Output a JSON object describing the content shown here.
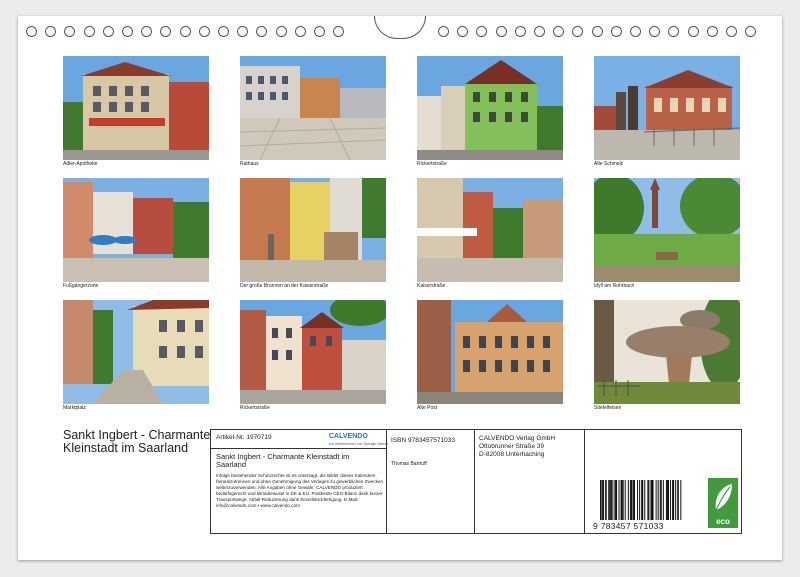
{
  "photos": [
    {
      "caption": "Adler-Apotheke"
    },
    {
      "caption": "Rathaus"
    },
    {
      "caption": "Rickertstraße"
    },
    {
      "caption": "Alte Schmelz"
    },
    {
      "caption": "Fußgängerzone"
    },
    {
      "caption": "Der große Brunnen an der Kaiserstraße"
    },
    {
      "caption": "Kaiserstraße"
    },
    {
      "caption": "Idyll am Rohrbach"
    },
    {
      "caption": "Marktplatz"
    },
    {
      "caption": "Rickertstraße"
    },
    {
      "caption": "Alte Post"
    },
    {
      "caption": "Stiefelfelsen"
    }
  ],
  "footer": {
    "title": "Sankt Ingbert - Charmante Kleinstadt im Saarland",
    "article_no": "Artikel-Nr. 1970719",
    "brand": "CALVENDO",
    "brand_sub": "ein Unternehmen von Springer Nature",
    "calendar_title": "Sankt Ingbert - Charmante Kleinstadt im Saarland",
    "legal_text": "Infolge bestehender Schutzrechte ist es untersagt, die Bilder dieses Kalenders herauszutrennen und ohne Genehmigung des Verlages zu gewerblichen Zwecken weiterzuverwenden. Alle Angaben ohne Gewähr. CALVENDO produziert bedarfsgerecht und klimabewusst in DE & EU. Postbeste CEG-Bilanz dank kurzer Transportwege. Abfall-Reduzierung dank Einzelstückfertigung. E-Mail: info@calvendo.com • www.calvendo.com",
    "isbn": "ISBN 9783457571033",
    "author": "Thomas Bartruff",
    "publisher_lines": [
      "CALVENDO Verlag GmbH",
      "Ottobrunner Straße 39",
      "D-82008 Unterhaching"
    ],
    "barcode_digits": "9 783457 571033",
    "eco_label": "eco"
  },
  "colors": {
    "sky": "#6aa7e0",
    "eco_green": "#3f9b3b"
  }
}
